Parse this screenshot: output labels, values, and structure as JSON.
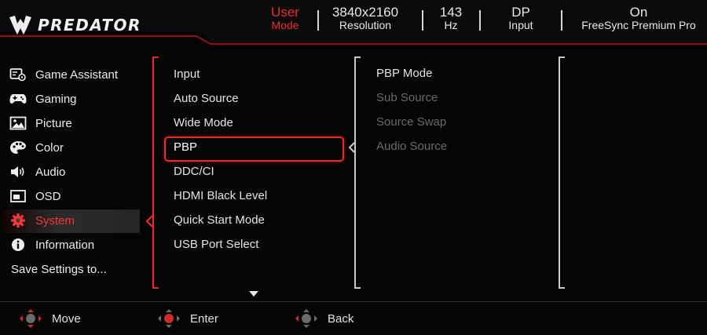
{
  "header": {
    "brand": "PREDATOR",
    "status": [
      {
        "value": "User",
        "label": "Mode",
        "active": true
      },
      {
        "value": "3840x2160",
        "label": "Resolution",
        "active": false
      },
      {
        "value": "143",
        "label": "Hz",
        "active": false
      },
      {
        "value": "DP",
        "label": "Input",
        "active": false
      },
      {
        "value": "On",
        "label": "FreeSync Premium Pro",
        "active": false
      }
    ]
  },
  "menu": {
    "items": [
      {
        "label": "Game Assistant",
        "icon": "game-assistant-icon"
      },
      {
        "label": "Gaming",
        "icon": "gamepad-icon"
      },
      {
        "label": "Picture",
        "icon": "picture-icon"
      },
      {
        "label": "Color",
        "icon": "palette-icon"
      },
      {
        "label": "Audio",
        "icon": "speaker-icon"
      },
      {
        "label": "OSD",
        "icon": "osd-icon"
      },
      {
        "label": "System",
        "icon": "gear-icon"
      },
      {
        "label": "Information",
        "icon": "info-icon"
      }
    ],
    "selected": "System",
    "save_settings": "Save Settings to..."
  },
  "submenu": {
    "items": [
      "Input",
      "Auto Source",
      "Wide Mode",
      "PBP",
      "DDC/CI",
      "HDMI Black Level",
      "Quick Start Mode",
      "USB Port Select"
    ],
    "highlighted": "PBP",
    "more_icon": "triangle-down-icon"
  },
  "pbp_options": {
    "items": [
      {
        "label": "PBP Mode",
        "enabled": true
      },
      {
        "label": "Sub Source",
        "enabled": false
      },
      {
        "label": "Source Swap",
        "enabled": false
      },
      {
        "label": "Audio Source",
        "enabled": false
      }
    ]
  },
  "footer": {
    "move": "Move",
    "enter": "Enter",
    "back": "Back"
  },
  "colors": {
    "accent": "#e52d2d",
    "background": "#050505",
    "text": "#e8e8e8",
    "disabled": "#6a6a6a"
  }
}
